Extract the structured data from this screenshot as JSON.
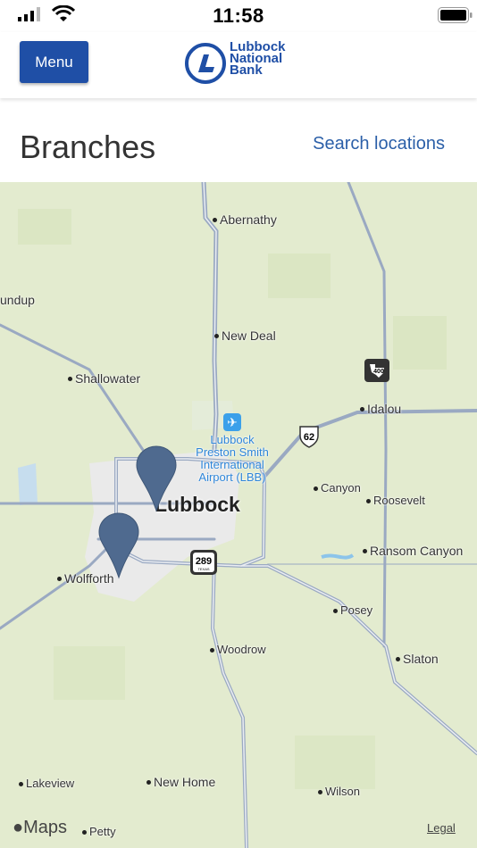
{
  "status_bar": {
    "time": "11:58"
  },
  "header": {
    "menu_label": "Menu",
    "logo_lines": [
      "Lubbock",
      "National",
      "Bank"
    ]
  },
  "page": {
    "title": "Branches",
    "search_link": "Search locations"
  },
  "map": {
    "city": "Lubbock",
    "airport": [
      "Lubbock",
      "Preston Smith",
      "International",
      "Airport (LBB)"
    ],
    "places": {
      "abernathy": "Abernathy",
      "new_deal": "New Deal",
      "shallowater": "Shallowater",
      "idalou": "Idalou",
      "roundup": "undup",
      "canyon": "Canyon",
      "roosevelt": "Roosevelt",
      "ransom_canyon": "Ransom Canyon",
      "wolfforth": "Wolfforth",
      "posey": "Posey",
      "woodrow": "Woodrow",
      "slaton": "Slaton",
      "lakeview": "Lakeview",
      "new_home": "New Home",
      "wilson": "Wilson",
      "petty": "Petty"
    },
    "shields": {
      "us62": "62",
      "us289": "289",
      "tx400": "400",
      "texas_tag": "TEXAS"
    },
    "attribution": "Maps",
    "legal": "Legal",
    "pins": [
      "branch-pin-lubbock",
      "branch-pin-wolfforth"
    ],
    "colors": {
      "land": "#e3ebcf",
      "road": "#9aa9c2",
      "urban": "#eaeaea",
      "pin": "#4f6a8f"
    }
  }
}
